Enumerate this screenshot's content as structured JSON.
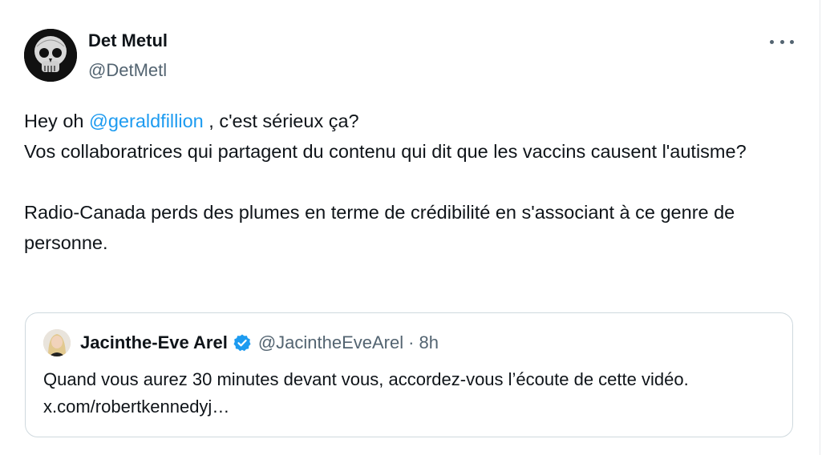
{
  "tweet": {
    "author": {
      "name": "Det Metul",
      "handle": "@DetMetl"
    },
    "text": {
      "line1_prefix": "Hey oh ",
      "mention": "@geraldfillion",
      "line1_suffix": " , c'est sérieux ça?",
      "line2": "Vos collaboratrices qui partagent du contenu qui dit que les vaccins causent l'autisme?",
      "line3": "Radio-Canada perds des plumes en terme de crédibilité en s'associant à ce genre de personne."
    },
    "more_icon": "more-horizontal-icon"
  },
  "quote": {
    "author": {
      "name": "Jacinthe-Eve Arel",
      "handle": "@JacintheEveArel",
      "separator": "·",
      "time": "8h",
      "verified_icon": "verified-badge-icon"
    },
    "text": "Quand vous aurez 30 minutes devant vous, accordez-vous l’écoute de cette vidéo. x.com/robertkennedyj…"
  },
  "colors": {
    "text": "#0f1419",
    "secondary": "#536471",
    "link": "#1d9bf0",
    "border": "#cfd9de"
  }
}
